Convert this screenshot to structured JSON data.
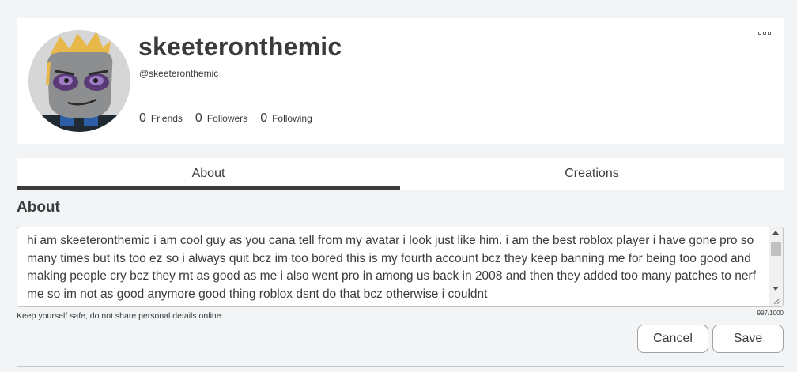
{
  "profile": {
    "display_name": "skeeteronthemic",
    "username": "@skeeteronthemic",
    "stats": [
      {
        "count": "0",
        "label": "Friends"
      },
      {
        "count": "0",
        "label": "Followers"
      },
      {
        "count": "0",
        "label": "Following"
      }
    ],
    "more_icon": "more-options-icon"
  },
  "tabs": [
    {
      "label": "About",
      "active": true
    },
    {
      "label": "Creations",
      "active": false
    }
  ],
  "about": {
    "heading": "About",
    "text": "hi am skeeteronthemic i am cool guy as you cana tell from my avatar i look just like him. i am the best roblox player i have gone pro so many times but its too ez so i always quit bcz im too bored this is my fourth account bcz they keep banning me for being too good and making people cry bcz they rnt as good as me i also went pro in among us back in 2008 and then they added too many patches to nerf me so im not as good anymore good thing roblox dsnt do that bcz otherwise i couldnt",
    "safety_note": "Keep yourself safe, do not share personal details online.",
    "char_count": "997/1000"
  },
  "actions": {
    "cancel_label": "Cancel",
    "save_label": "Save"
  },
  "colors": {
    "background": "#f2f4f5",
    "card": "#ffffff",
    "text": "#393b3d",
    "tab_indicator": "#393b3d",
    "avatar_hair": "#e8b84a"
  }
}
